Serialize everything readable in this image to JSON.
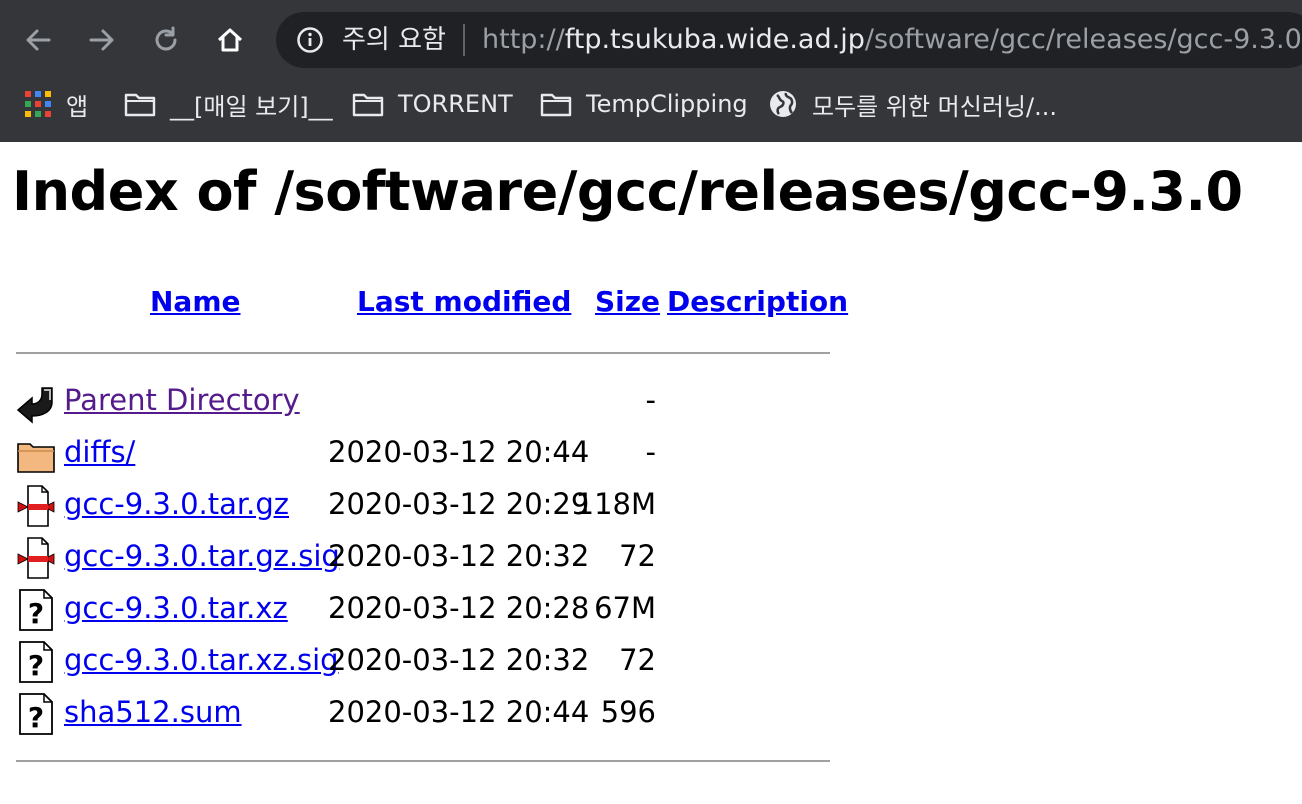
{
  "browser": {
    "security_label": "주의 요함",
    "url_scheme": "http://",
    "url_host": "ftp.tsukuba.wide.ad.jp",
    "url_path": "/software/gcc/releases/gcc-9.3.0/",
    "bookmarks": [
      {
        "label": "앱",
        "icon": "apps-grid-icon"
      },
      {
        "label": "__[매일 보기]__",
        "icon": "folder-icon"
      },
      {
        "label": "TORRENT",
        "icon": "folder-icon"
      },
      {
        "label": "TempClipping",
        "icon": "folder-icon"
      },
      {
        "label": "모두를 위한 머신러닝/...",
        "icon": "globe-icon"
      }
    ]
  },
  "page": {
    "title": "Index of /software/gcc/releases/gcc-9.3.0",
    "columns": {
      "name": "Name",
      "last_modified": "Last modified",
      "size": "Size",
      "description": "Description"
    },
    "entries": [
      {
        "name": "Parent Directory",
        "date": "",
        "size": "-",
        "icon": "back-arrow-icon"
      },
      {
        "name": "diffs/",
        "date": "2020-03-12 20:44",
        "size": "-",
        "icon": "folder-icon"
      },
      {
        "name": "gcc-9.3.0.tar.gz",
        "date": "2020-03-12 20:29",
        "size": "118M",
        "icon": "compressed-file-icon"
      },
      {
        "name": "gcc-9.3.0.tar.gz.sig",
        "date": "2020-03-12 20:32",
        "size": "72",
        "icon": "compressed-file-icon"
      },
      {
        "name": "gcc-9.3.0.tar.xz",
        "date": "2020-03-12 20:28",
        "size": "67M",
        "icon": "unknown-file-icon"
      },
      {
        "name": "gcc-9.3.0.tar.xz.sig",
        "date": "2020-03-12 20:32",
        "size": "72",
        "icon": "unknown-file-icon"
      },
      {
        "name": "sha512.sum",
        "date": "2020-03-12 20:44",
        "size": "596",
        "icon": "unknown-file-icon"
      }
    ]
  }
}
